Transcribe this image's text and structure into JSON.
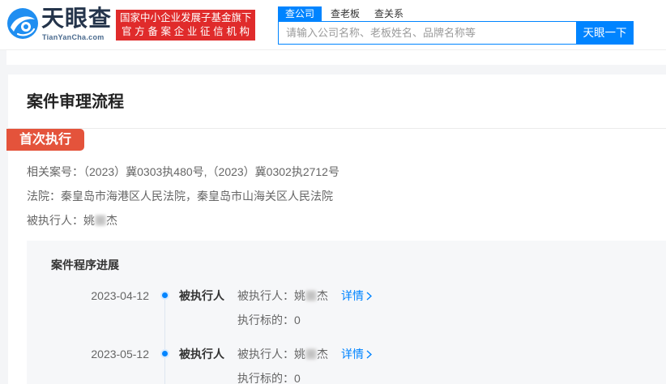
{
  "header": {
    "logo_text": "天眼查",
    "logo_sub": "TianYanCha.com",
    "badge_line1": "国家中小企业发展子基金旗下",
    "badge_line2": "官方备案企业征信机构",
    "search_tabs": [
      {
        "label": "查公司",
        "active": true
      },
      {
        "label": "查老板",
        "active": false
      },
      {
        "label": "查关系",
        "active": false
      }
    ],
    "search_placeholder": "请输入公司名称、老板姓名、品牌名称等",
    "search_value": "",
    "search_button": "天眼一下"
  },
  "case": {
    "title": "案件审理流程",
    "stage_tag": "首次执行",
    "info": [
      {
        "label": "相关案号：",
        "value": "（2023）冀0303执480号,（2023）冀0302执2712号"
      },
      {
        "label": "法院：",
        "value": "秦皇岛市海港区人民法院，秦皇岛市山海关区人民法院"
      },
      {
        "label": "被执行人：",
        "name_first": "姚",
        "name_last": "杰"
      }
    ],
    "progress": {
      "title": "案件程序进展",
      "entries": [
        {
          "date": "2023-04-12",
          "role": "被执行人",
          "detail_label": "被执行人：",
          "name_first": "姚",
          "name_last": "杰",
          "link": "详情",
          "subject_label": "执行标的：",
          "subject_value": "0"
        },
        {
          "date": "2023-05-12",
          "role": "被执行人",
          "detail_label": "被执行人：",
          "name_first": "姚",
          "name_last": "杰",
          "link": "详情",
          "subject_label": "执行标的：",
          "subject_value": "0"
        }
      ]
    }
  },
  "colors": {
    "brand": "#0084ff",
    "tag": "#e4533b",
    "badge": "#e02b2b",
    "panel": "#f6f7f9"
  },
  "icons": {
    "logo": "tianyancha-logo-icon",
    "detail_arrow": "chevron-right-icon",
    "timeline_marker": "timeline-dot-icon",
    "masked_name": "blurred-char"
  }
}
